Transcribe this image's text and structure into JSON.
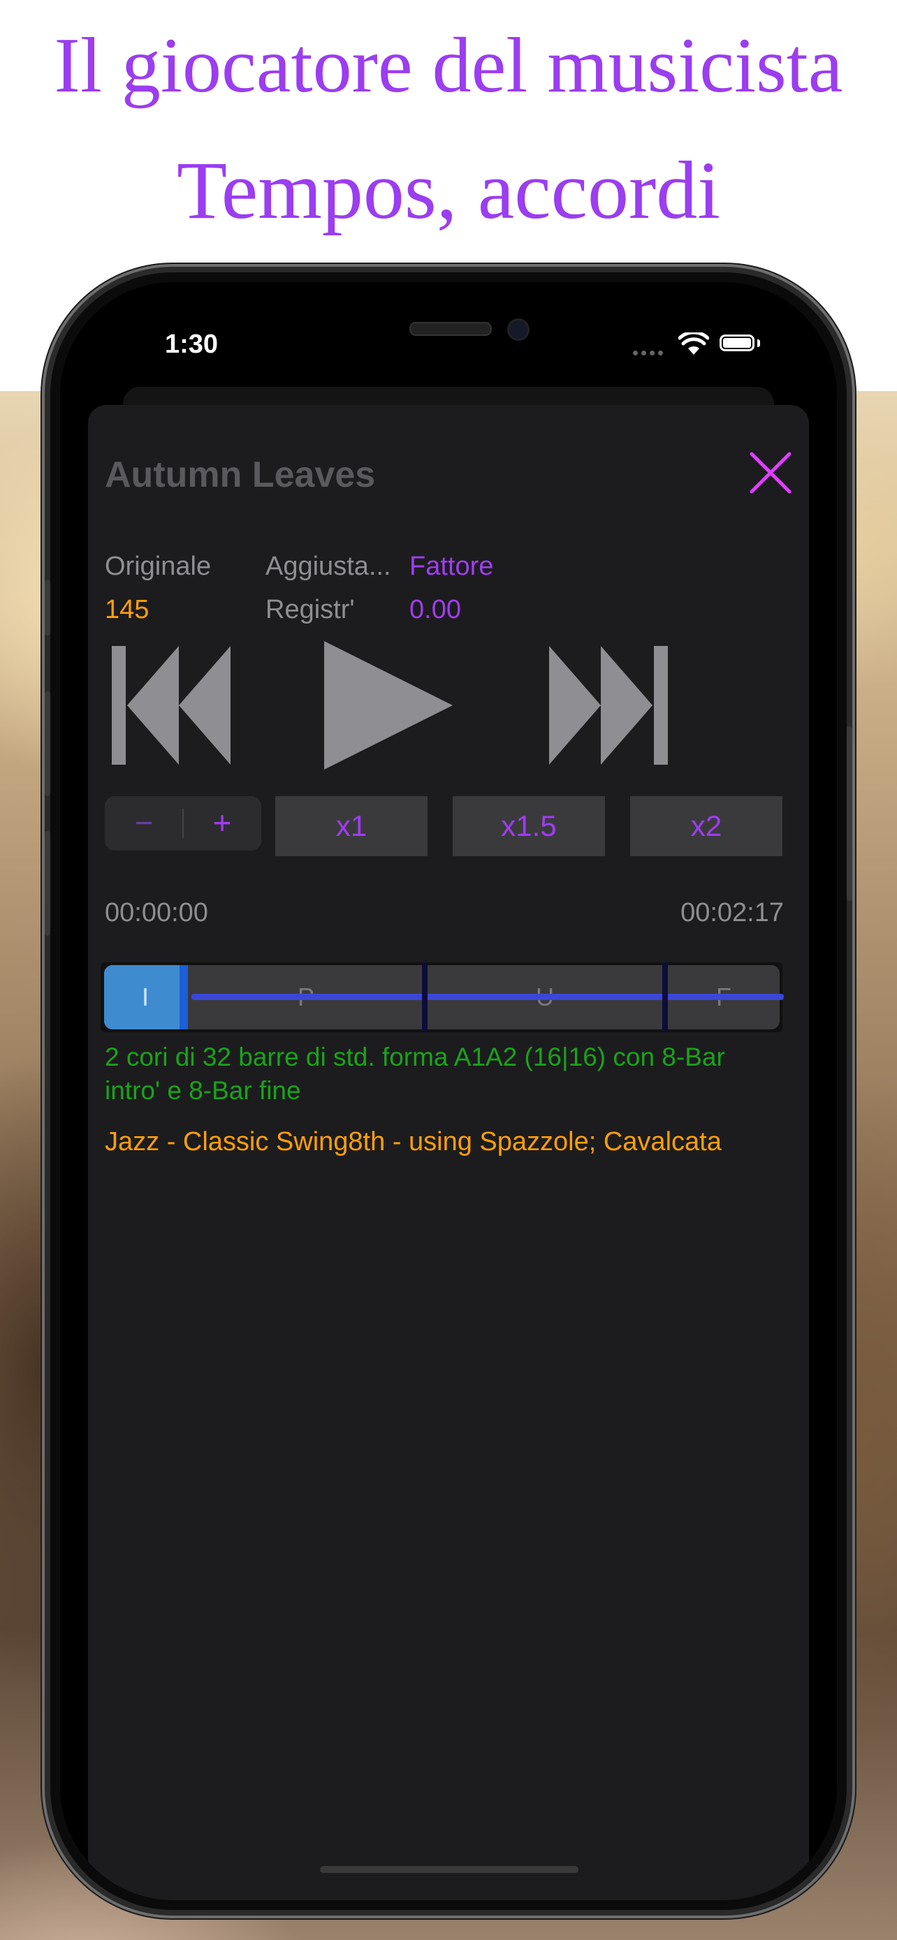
{
  "promo": {
    "line1": "Il giocatore del musicista",
    "line2": "Tempos, accordi"
  },
  "status_bar": {
    "time": "1:30"
  },
  "player": {
    "song_title": "Autumn Leaves",
    "tempo": {
      "original_label": "Originale",
      "original_value": "145",
      "adjust_label": "Aggiusta...",
      "adjust_sublabel": "Registr'",
      "factor_label": "Fattore",
      "factor_value": "0.00"
    },
    "stepper": {
      "minus": "−",
      "plus": "+"
    },
    "speed_buttons": [
      "x1",
      "x1.5",
      "x2"
    ],
    "time_elapsed": "00:00:00",
    "time_total": "00:02:17",
    "sections": [
      "I",
      "P",
      "U",
      "F"
    ],
    "form_description": "2 cori di 32 barre di std. forma A1A2 (16|16) con 8-Bar intro' e 8-Bar fine",
    "style_description": "Jazz - Classic Swing8th - using Spazzole; Cavalcata"
  },
  "colors": {
    "accent": "#a03df0",
    "headline": "#9b3df0",
    "orange": "#ff9f0a",
    "green": "#1aa31a",
    "close": "#e040fb",
    "playhead": "#3f8bd0",
    "progress": "#3b47d6"
  }
}
